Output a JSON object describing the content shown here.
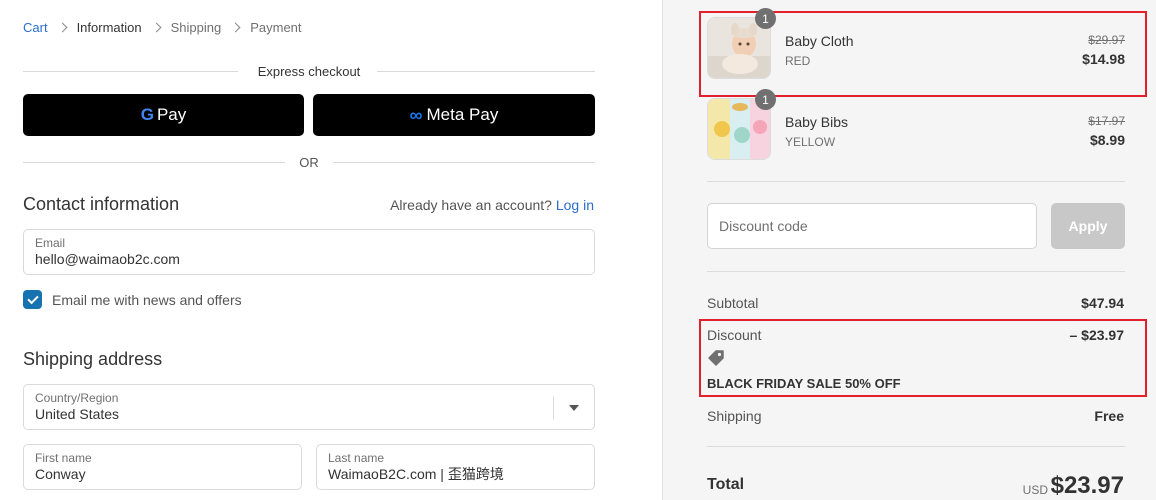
{
  "breadcrumb": {
    "items": [
      "Cart",
      "Information",
      "Shipping",
      "Payment"
    ]
  },
  "express": {
    "title": "Express checkout",
    "gpay_g": "G",
    "gpay_label": "Pay",
    "metapay_label": "Meta Pay",
    "or_label": "OR"
  },
  "contact": {
    "title": "Contact information",
    "account_prompt": "Already have an account?",
    "login_label": "Log in",
    "email_label": "Email",
    "email_value": "hello@waimaob2c.com",
    "newsletter_label": "Email me with news and offers",
    "newsletter_checked": true
  },
  "shipping": {
    "title": "Shipping address",
    "country_label": "Country/Region",
    "country_value": "United States",
    "first_name_label": "First name",
    "first_name_value": "Conway",
    "last_name_label": "Last name",
    "last_name_value": "WaimaoB2C.com | 歪猫跨境"
  },
  "order": {
    "items": [
      {
        "name": "Baby Cloth",
        "variant": "RED",
        "qty": "1",
        "old_price": "$29.97",
        "price": "$14.98"
      },
      {
        "name": "Baby Bibs",
        "variant": "YELLOW",
        "qty": "1",
        "old_price": "$17.97",
        "price": "$8.99"
      }
    ],
    "discount_placeholder": "Discount code",
    "apply_label": "Apply",
    "subtotal_label": "Subtotal",
    "subtotal_value": "$47.94",
    "discount_label": "Discount",
    "discount_value": "– $23.97",
    "discount_code": "BLACK FRIDAY SALE 50% OFF",
    "shipping_label": "Shipping",
    "shipping_value": "Free",
    "total_label": "Total",
    "total_currency": "USD",
    "total_value": "$23.97"
  },
  "colors": {
    "link": "#2c6ecb",
    "checkbox": "#1773b0",
    "highlight": "#e0202a",
    "sidebar_bg": "#f5f5f5"
  }
}
